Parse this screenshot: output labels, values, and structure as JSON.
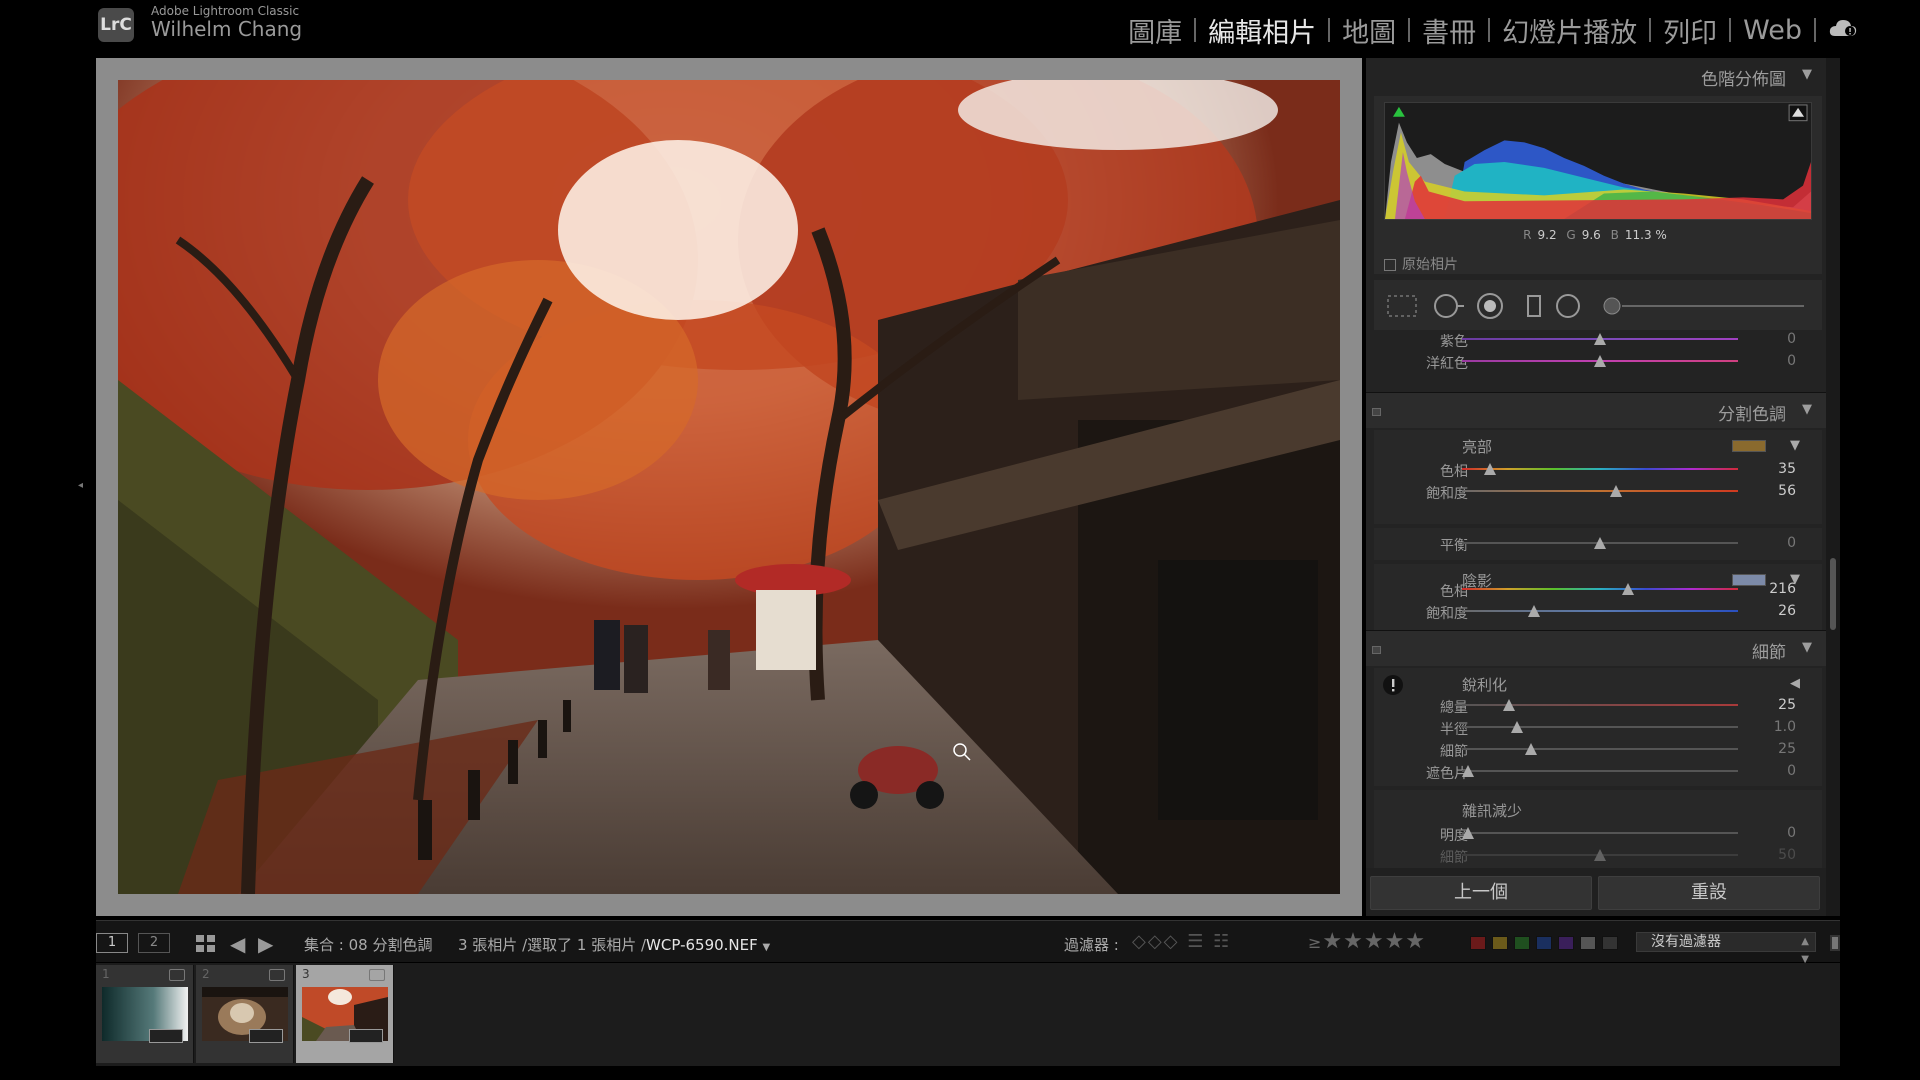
{
  "app": {
    "product": "Adobe Lightroom Classic",
    "user": "Wilhelm Chang",
    "logo_text": "LrC"
  },
  "modules": [
    {
      "label": "圖庫",
      "active": false
    },
    {
      "label": "編輯相片",
      "active": true
    },
    {
      "label": "地圖",
      "active": false
    },
    {
      "label": "書冊",
      "active": false
    },
    {
      "label": "幻燈片播放",
      "active": false
    },
    {
      "label": "列印",
      "active": false
    },
    {
      "label": "Web",
      "active": false
    }
  ],
  "histogram": {
    "title": "色階分佈圖",
    "r_label": "R",
    "r_value": "9.2",
    "g_label": "G",
    "g_value": "9.6",
    "b_label": "B",
    "b_value": "11.3 %",
    "original_photo_label": "原始相片"
  },
  "hsl_rows": [
    {
      "label": "紫色",
      "value": "0",
      "position": 0.5
    },
    {
      "label": "洋紅色",
      "value": "0",
      "position": 0.5
    }
  ],
  "split_toning": {
    "title": "分割色調",
    "highlights": {
      "title": "亮部",
      "swatch_color": "#8a6a2e",
      "hue_label": "色相",
      "hue_value": "35",
      "hue_position": 0.1,
      "sat_label": "飽和度",
      "sat_value": "56",
      "sat_position": 0.56
    },
    "balance": {
      "label": "平衡",
      "value": "0",
      "position": 0.5
    },
    "shadows": {
      "title": "陰影",
      "swatch_color": "#7c8aa8",
      "hue_label": "色相",
      "hue_value": "216",
      "hue_position": 0.6,
      "sat_label": "飽和度",
      "sat_value": "26",
      "sat_position": 0.26
    }
  },
  "detail": {
    "title": "細節",
    "sharpening": {
      "title": "銳利化",
      "rows": [
        {
          "label": "總量",
          "value": "25",
          "position": 0.17
        },
        {
          "label": "半徑",
          "value": "1.0",
          "position": 0.2
        },
        {
          "label": "細節",
          "value": "25",
          "position": 0.25
        },
        {
          "label": "遮色片",
          "value": "0",
          "position": 0.0
        }
      ]
    },
    "noise_reduction": {
      "title": "雜訊減少",
      "rows": [
        {
          "label": "明度",
          "value": "0",
          "position": 0.0
        },
        {
          "label": "細節",
          "value": "50",
          "position": 0.5
        }
      ]
    }
  },
  "buttons": {
    "previous": "上一個",
    "reset": "重設"
  },
  "film_toolbar": {
    "view1": "1",
    "view2": "2",
    "collection": "集合 : 08 分割色調",
    "count_text": "3 張相片 /選取了 1 張相片 /",
    "filename": "WCP-6590.NEF",
    "filter_label": "過濾器 :",
    "filter_value": "沒有過濾器",
    "rating_prefix": "≥",
    "stars": "★★★★★",
    "color_labels": [
      "#6b1a1a",
      "#6b5a1a",
      "#1f4f1f",
      "#1a2f5f",
      "#3a1f5a",
      "#555555",
      "#333333"
    ]
  },
  "filmstrip": [
    {
      "num": "1",
      "selected": false,
      "kind": "gradient"
    },
    {
      "num": "2",
      "selected": false,
      "kind": "cat"
    },
    {
      "num": "3",
      "selected": true,
      "kind": "autumn"
    }
  ]
}
